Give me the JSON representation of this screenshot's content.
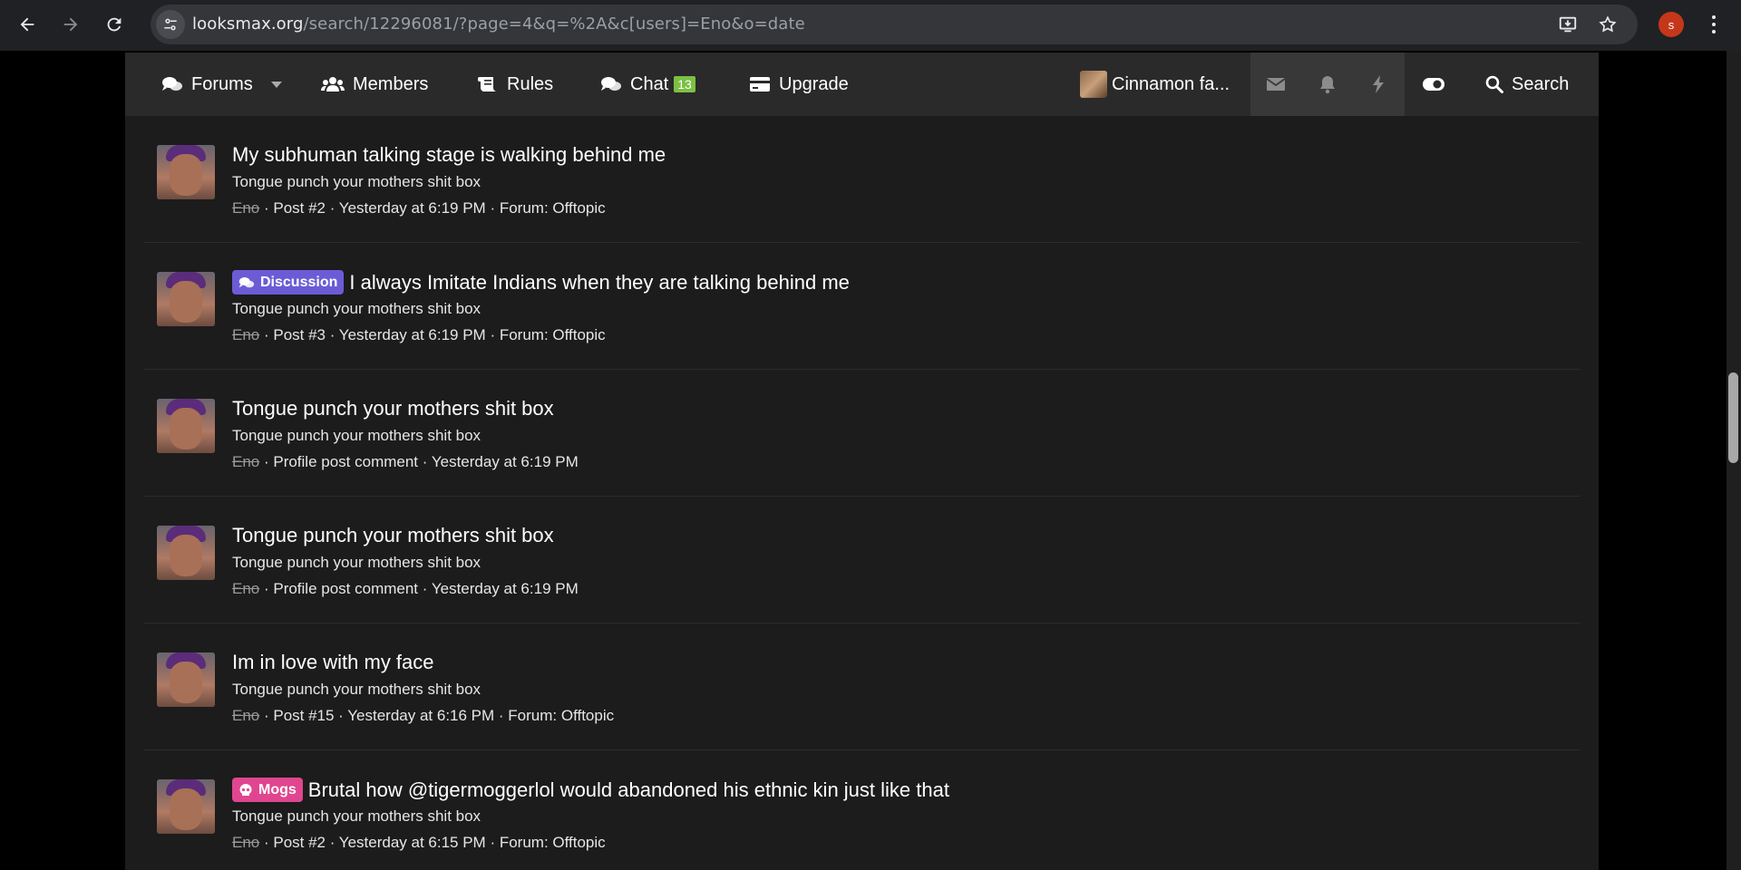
{
  "browser": {
    "url_domain": "looksmax.org",
    "url_path": "/search/12296081/?page=4&q=%2A&c[users]=Eno&o=date",
    "profile_initial": "s"
  },
  "forum_nav": {
    "forums": "Forums",
    "members": "Members",
    "rules": "Rules",
    "chat": "Chat",
    "chat_count": "13",
    "upgrade": "Upgrade",
    "user_name": "Cinnamon fa...",
    "search": "Search"
  },
  "results": [
    {
      "prefix": "",
      "title": "My subhuman talking stage is walking behind me",
      "snippet": "Tongue punch your mothers shit box",
      "user": "Eno",
      "meta": " · Post #2 · Yesterday at 6:19 PM · Forum: Offtopic"
    },
    {
      "prefix": "Discussion",
      "title": "I always Imitate Indians when they are talking behind me",
      "snippet": "Tongue punch your mothers shit box",
      "user": "Eno",
      "meta": " · Post #3 · Yesterday at 6:19 PM · Forum: Offtopic"
    },
    {
      "prefix": "",
      "title": "Tongue punch your mothers shit box",
      "snippet": "Tongue punch your mothers shit box",
      "user": "Eno",
      "meta": " · Profile post comment · Yesterday at 6:19 PM"
    },
    {
      "prefix": "",
      "title": "Tongue punch your mothers shit box",
      "snippet": "Tongue punch your mothers shit box",
      "user": "Eno",
      "meta": " · Profile post comment · Yesterday at 6:19 PM"
    },
    {
      "prefix": "",
      "title": "Im in love with my face",
      "snippet": "Tongue punch your mothers shit box",
      "user": "Eno",
      "meta": " · Post #15 · Yesterday at 6:16 PM · Forum: Offtopic"
    },
    {
      "prefix": "Mogs",
      "title": "Brutal how @tigermoggerlol would abandoned his ethnic kin just like that",
      "snippet": "Tongue punch your mothers shit box",
      "user": "Eno",
      "meta": " · Post #2 · Yesterday at 6:15 PM · Forum: Offtopic"
    }
  ],
  "colors": {
    "discussion_prefix": "#6b5cd6",
    "mogs_prefix": "#e0468f",
    "chat_badge": "#7cc043"
  }
}
